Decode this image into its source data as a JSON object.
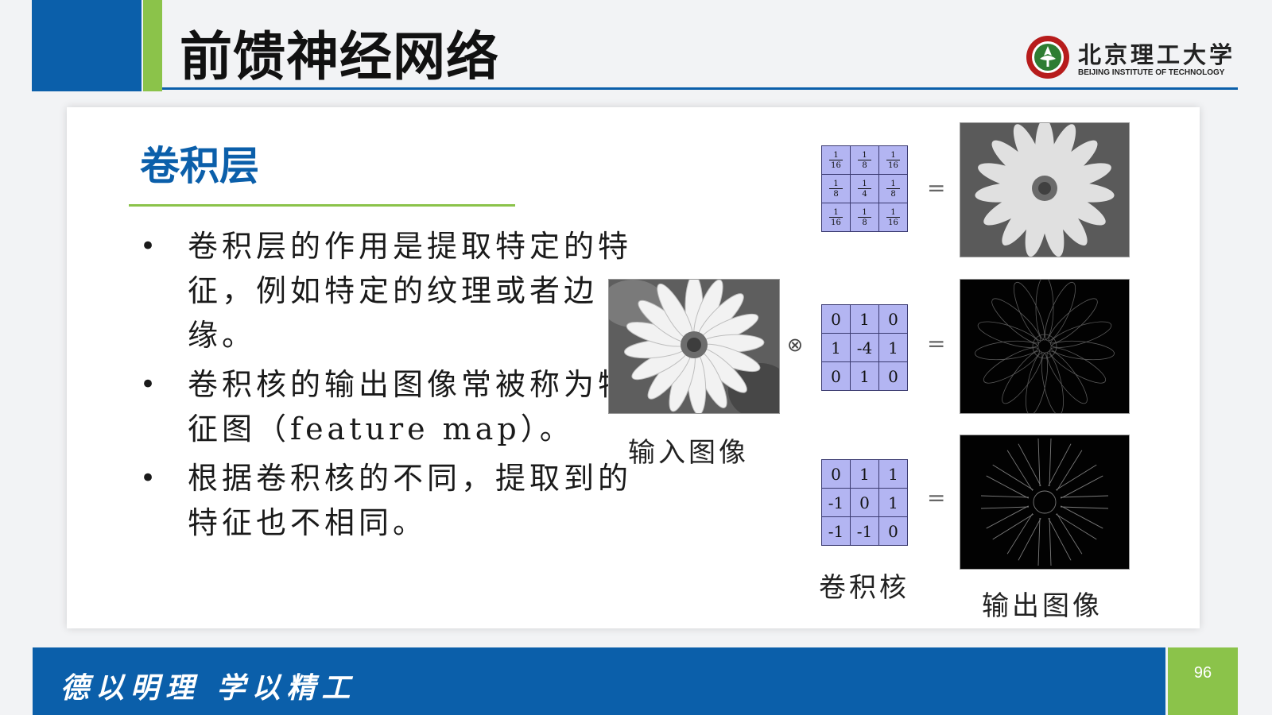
{
  "header": {
    "title": "前馈神经网络",
    "logo_cn": "北京理工大学",
    "logo_en": "BEIJING INSTITUTE OF TECHNOLOGY"
  },
  "section": {
    "title": "卷积层",
    "bullets": [
      "卷积层的作用是提取特定的特征，例如特定的纹理或者边缘。",
      "卷积核的输出图像常被称为特征图（feature map）。",
      "根据卷积核的不同，提取到的特征也不相同。"
    ]
  },
  "diagram": {
    "input_caption": "输入图像",
    "kernel_caption": "卷积核",
    "output_caption": "输出图像",
    "equals": "=",
    "conv_symbol": "⊗",
    "kernels": [
      [
        [
          "1",
          "16"
        ],
        [
          "1",
          "8"
        ],
        [
          "1",
          "16"
        ],
        [
          "1",
          "8"
        ],
        [
          "1",
          "4"
        ],
        [
          "1",
          "8"
        ],
        [
          "1",
          "16"
        ],
        [
          "1",
          "8"
        ],
        [
          "1",
          "16"
        ]
      ],
      [
        "0",
        "1",
        "0",
        "1",
        "-4",
        "1",
        "0",
        "1",
        "0"
      ],
      [
        "0",
        "1",
        "1",
        "-1",
        "0",
        "1",
        "-1",
        "-1",
        "0"
      ]
    ]
  },
  "footer": {
    "motto": "德以明理 学以精工",
    "page_number": "96"
  },
  "colors": {
    "brand_blue": "#0b5faa",
    "brand_green": "#8bc34a",
    "kernel_fill": "#b3b5f2"
  }
}
